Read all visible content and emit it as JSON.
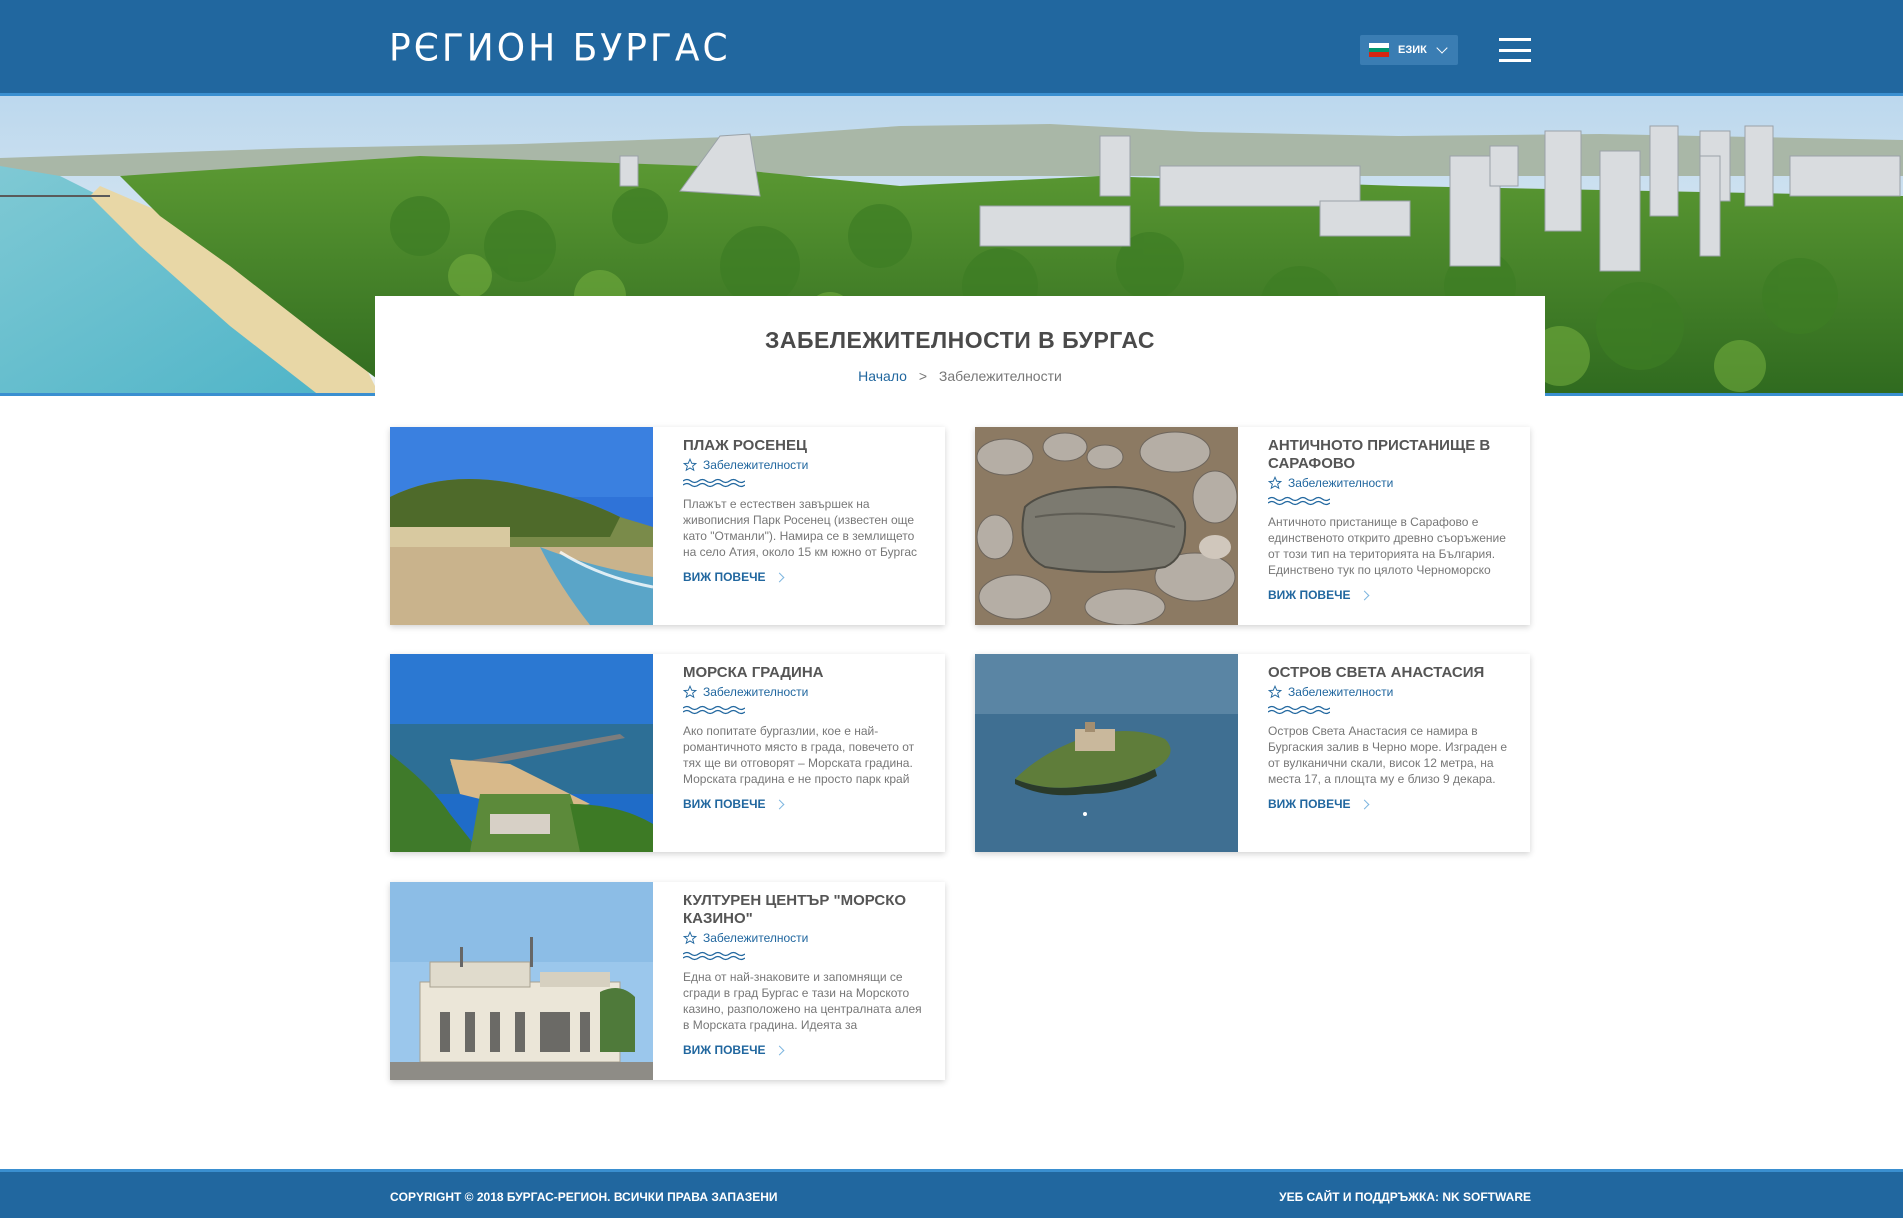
{
  "header": {
    "logo": "РЄГИОН БУРГАС",
    "language_label": "ЕЗИК",
    "flag_colors": [
      "#ffffff",
      "#00966e",
      "#d62612"
    ]
  },
  "page": {
    "title": "ЗАБЕЛЕЖИТЕЛНОСТИ В БУРГАС",
    "breadcrumb": {
      "home": "Начало",
      "separator": ">",
      "current": "Забележителности"
    }
  },
  "cards": [
    {
      "title": "ПЛАЖ РОСЕНЕЦ",
      "category": "Забележителности",
      "excerpt": "Плажът е естествен завършек на живописния Парк Росенец (известен още като \"Отманли\"). Намира се в землището на село Атия, около 15 км южно от Бургас",
      "more": "ВИЖ ПОВЕЧЕ"
    },
    {
      "title": "АНТИЧНОТО ПРИСТАНИЩЕ В САРАФОВО",
      "category": "Забележителности",
      "excerpt": "Античното пристанище в Сарафово е единственото открито древно съоръжение от този тип на територията на България. Единствено тук по цялото Черноморско",
      "more": "ВИЖ ПОВЕЧЕ"
    },
    {
      "title": "МОРСКА ГРАДИНА",
      "category": "Забележителности",
      "excerpt": "Ако попитате бургазлии, кое е най-романтичното място в града, повечето от тях ще ви отговорят – Морската градина. Морската градина е не просто парк край",
      "more": "ВИЖ ПОВЕЧЕ"
    },
    {
      "title": "ОСТРОВ СВЕТА АНАСТАСИЯ",
      "category": "Забележителности",
      "excerpt": "Остров Света Анастасия се намира в Бургаския залив в Черно море. Изграден е от вулканични скали, висок 12 метра, на места 17, а площта му е близо 9 декара.",
      "more": "ВИЖ ПОВЕЧЕ"
    },
    {
      "title": "КУЛТУРЕН ЦЕНТЪР \"МОРСКО КАЗИНО\"",
      "category": "Забележителности",
      "excerpt": "Една от най-знаковите и запомнящи се сгради в град Бургас е тази на Морското казино, разположено на централната алея в Морската градина. Идеята за",
      "more": "ВИЖ ПОВЕЧЕ"
    }
  ],
  "footer": {
    "copyright": "COPYRIGHT © 2018 БУРГАС-РЕГИОН. ВСИЧКИ ПРАВА ЗАПАЗЕНИ",
    "credits": "УЕБ САЙТ И ПОДДРЪЖКА: NK SOFTWARE"
  },
  "colors": {
    "brand_blue": "#21679f",
    "accent_light_blue": "#3a8fd0"
  }
}
